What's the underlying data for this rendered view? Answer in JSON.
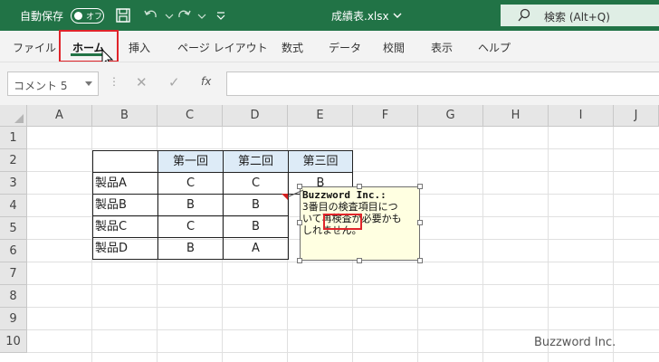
{
  "titlebar": {
    "autosave_label": "自動保存",
    "autosave_state": "オフ",
    "file_name": "成績表.xlsx",
    "search_placeholder": "検索 (Alt+Q)"
  },
  "ribbon": {
    "tabs": [
      "ファイル",
      "ホーム",
      "挿入",
      "ページ レイアウト",
      "数式",
      "データ",
      "校閲",
      "表示",
      "ヘルプ"
    ],
    "active_tab": "ホーム"
  },
  "formula_bar": {
    "name_box": "コメント 5",
    "fx": "fx",
    "formula": ""
  },
  "grid": {
    "columns": [
      "A",
      "B",
      "C",
      "D",
      "E",
      "F",
      "G",
      "H",
      "I",
      "J"
    ],
    "rows": [
      "1",
      "2",
      "3",
      "4",
      "5",
      "6",
      "7",
      "8",
      "9",
      "10"
    ]
  },
  "table": {
    "headers": [
      "",
      "第一回",
      "第二回",
      "第三回"
    ],
    "rows": [
      {
        "product": "製品A",
        "c": "C",
        "d": "C",
        "e": "B"
      },
      {
        "product": "製品B",
        "c": "B",
        "d": "B",
        "e": ""
      },
      {
        "product": "製品C",
        "c": "C",
        "d": "B",
        "e": ""
      },
      {
        "product": "製品D",
        "c": "B",
        "d": "A",
        "e": ""
      }
    ]
  },
  "comment": {
    "author": "Buzzword Inc.:",
    "line1": "3番目の検査項目につ",
    "line2": "いて再検査が必要かも",
    "line3": "しれません。"
  },
  "watermark": "Buzzword Inc.",
  "colors": {
    "title_bar": "#217346",
    "header_fill": "#ddebf7",
    "comment_fill": "#ffffe1",
    "highlight": "#e0242a"
  }
}
